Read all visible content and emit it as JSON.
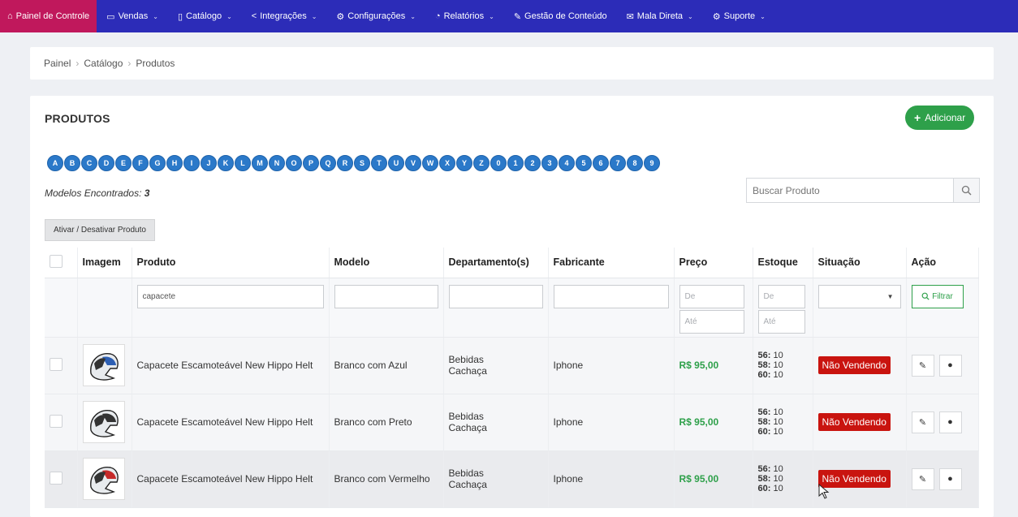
{
  "nav": [
    {
      "icon": "⌂",
      "label": "Painel de Controle",
      "chev": false
    },
    {
      "icon": "▭",
      "label": "Vendas",
      "chev": true
    },
    {
      "icon": "▯",
      "label": "Catálogo",
      "chev": true
    },
    {
      "icon": "<",
      "label": "Integrações",
      "chev": true
    },
    {
      "icon": "⚙",
      "label": "Configurações",
      "chev": true
    },
    {
      "icon": "◔",
      "label": "Relatórios",
      "chev": true
    },
    {
      "icon": "✎",
      "label": "Gestão de Conteúdo",
      "chev": false
    },
    {
      "icon": "✉",
      "label": "Mala Direta",
      "chev": true
    },
    {
      "icon": "⚙",
      "label": "Suporte",
      "chev": true
    }
  ],
  "breadcrumb": [
    "Painel",
    "Catálogo",
    "Produtos"
  ],
  "page_title": "PRODUTOS",
  "add_button": "Adicionar",
  "letters": [
    "A",
    "B",
    "C",
    "D",
    "E",
    "F",
    "G",
    "H",
    "I",
    "J",
    "K",
    "L",
    "M",
    "N",
    "O",
    "P",
    "Q",
    "R",
    "S",
    "T",
    "U",
    "V",
    "W",
    "X",
    "Y",
    "Z",
    "0",
    "1",
    "2",
    "3",
    "4",
    "5",
    "6",
    "7",
    "8",
    "9"
  ],
  "found_label": "Modelos Encontrados:",
  "found_count": "3",
  "search_placeholder": "Buscar Produto",
  "toggle_button": "Ativar / Desativar Produto",
  "columns": [
    "Imagem",
    "Produto",
    "Modelo",
    "Departamento(s)",
    "Fabricante",
    "Preço",
    "Estoque",
    "Situação",
    "Ação"
  ],
  "filters": {
    "produto": "capacete",
    "preco_de": "De",
    "preco_ate": "Até",
    "estoque_de": "De",
    "estoque_ate": "Até",
    "filtrar": "Filtrar"
  },
  "rows": [
    {
      "produto": "Capacete Escamoteável New Hippo Helt",
      "modelo": "Branco com Azul",
      "departamentos": [
        "Bebidas",
        "Cachaça"
      ],
      "fabricante": "Iphone",
      "preco": "R$ 95,00",
      "estoque": [
        [
          "56:",
          "10"
        ],
        [
          "58:",
          "10"
        ],
        [
          "60:",
          "10"
        ]
      ],
      "situacao": "Não Vendendo",
      "accent": "#2d5fb3"
    },
    {
      "produto": "Capacete Escamoteável New Hippo Helt",
      "modelo": "Branco com Preto",
      "departamentos": [
        "Bebidas",
        "Cachaça"
      ],
      "fabricante": "Iphone",
      "preco": "R$ 95,00",
      "estoque": [
        [
          "56:",
          "10"
        ],
        [
          "58:",
          "10"
        ],
        [
          "60:",
          "10"
        ]
      ],
      "situacao": "Não Vendendo",
      "accent": "#333333"
    },
    {
      "produto": "Capacete Escamoteável New Hippo Helt",
      "modelo": "Branco com Vermelho",
      "departamentos": [
        "Bebidas",
        "Cachaça"
      ],
      "fabricante": "Iphone",
      "preco": "R$ 95,00",
      "estoque": [
        [
          "56:",
          "10"
        ],
        [
          "58:",
          "10"
        ],
        [
          "60:",
          "10"
        ]
      ],
      "situacao": "Não Vendendo",
      "accent": "#c62a2a"
    }
  ],
  "colors": {
    "navbar": "#2c2cb8",
    "nav_active": "#c0185c",
    "letter": "#2b79c9",
    "success": "#2ea04a",
    "danger": "#c9140f"
  }
}
